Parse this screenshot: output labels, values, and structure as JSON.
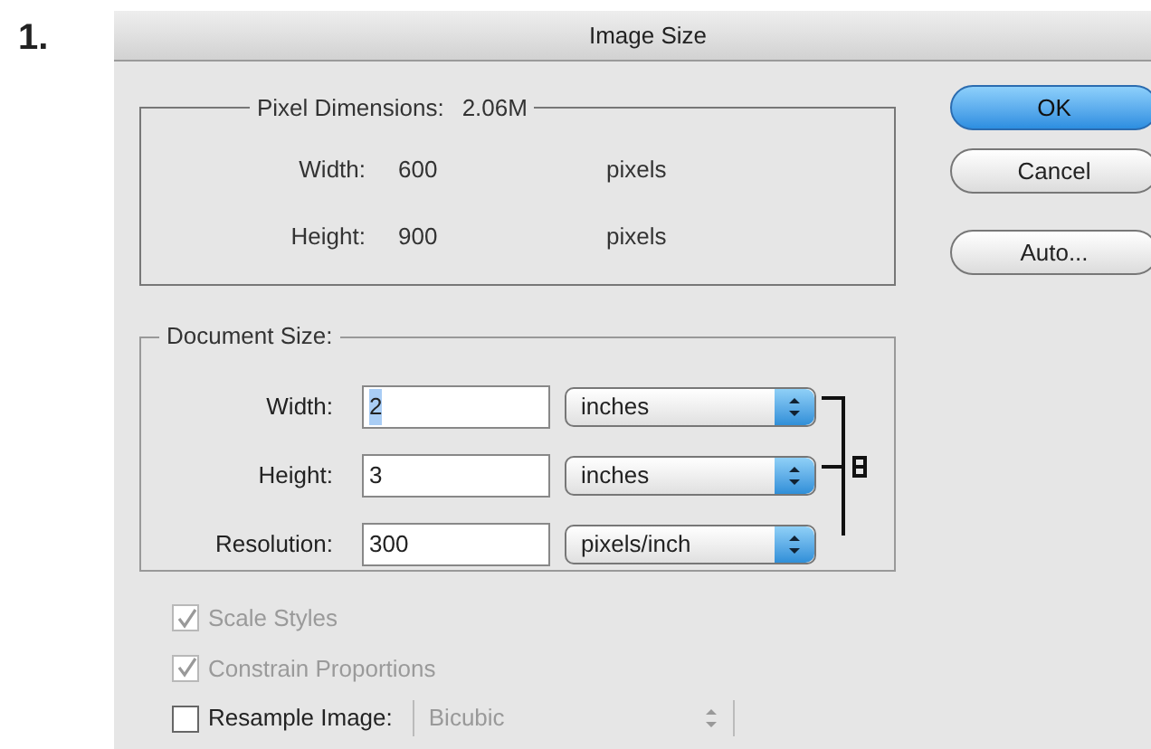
{
  "figure_label": "1.",
  "window": {
    "title": "Image Size"
  },
  "pixel_dimensions": {
    "legend": "Pixel Dimensions:",
    "value": "2.06M",
    "rows": [
      {
        "label": "Width:",
        "value": "600",
        "unit": "pixels"
      },
      {
        "label": "Height:",
        "value": "900",
        "unit": "pixels"
      }
    ]
  },
  "buttons": [
    {
      "label": "OK",
      "kind": "default"
    },
    {
      "label": "Cancel",
      "kind": "normal"
    },
    {
      "label": "Auto...",
      "kind": "normal"
    }
  ],
  "document_size": {
    "legend": "Document Size:",
    "linked": true,
    "rows": [
      {
        "label": "Width:",
        "value": "2",
        "value_selected": true,
        "unit": "inches"
      },
      {
        "label": "Height:",
        "value": "3",
        "value_selected": false,
        "unit": "inches"
      },
      {
        "label": "Resolution:",
        "value": "300",
        "value_selected": false,
        "unit": "pixels/inch"
      }
    ]
  },
  "options": [
    {
      "label": "Scale Styles",
      "checked": true,
      "disabled": true
    },
    {
      "label": "Constrain Proportions",
      "checked": true,
      "disabled": true
    }
  ],
  "resample": {
    "label": "Resample Image:",
    "checked": false,
    "method": {
      "value": "Bicubic",
      "disabled": true
    }
  }
}
